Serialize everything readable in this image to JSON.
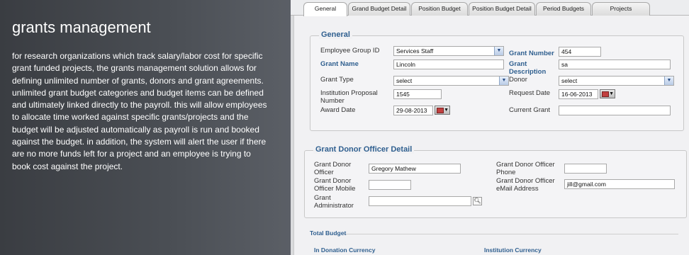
{
  "promo": {
    "heading": "grants management",
    "body": "for research organizations which track salary/labor cost for specific grant funded projects, the grants management solution allows for defining unlimited number of grants, donors and grant agreements.  unlimited grant budget categories and budget items can be defined and ultimately linked directly to the payroll.  this will allow employees to allocate time worked against specific grants/projects and the budget will be adjusted automatically as payroll is run and booked against the budget. in addition, the system will alert the user if there are no more funds left for a project and an employee is trying to book cost against the project."
  },
  "tabs": [
    {
      "label": "General",
      "active": true
    },
    {
      "label": "Grand Budget Detail"
    },
    {
      "label": "Position Budget"
    },
    {
      "label": "Position Budget Detail"
    },
    {
      "label": "Period Budgets"
    },
    {
      "label": "Projects"
    }
  ],
  "general": {
    "legend": "General",
    "employee_group_label": "Employee Group ID",
    "employee_group_value": "Services Staff",
    "grant_number_label": "Grant Number",
    "grant_number_value": "454",
    "grant_name_label": "Grant Name",
    "grant_name_value": "Lincoln",
    "grant_description_label": "Grant Description",
    "grant_description_value": "sa",
    "grant_type_label": "Grant Type",
    "grant_type_value": "select",
    "donor_label": "Donor",
    "donor_value": "select",
    "institution_proposal_label": "Institution Proposal Number",
    "institution_proposal_value": "1545",
    "request_date_label": "Request Date",
    "request_date_value": "16-06-2013",
    "award_date_label": "Award Date",
    "award_date_value": "29-08-2013",
    "current_grant_label": "Current Grant",
    "current_grant_value": ""
  },
  "donor_officer": {
    "legend": "Grant Donor Officer Detail",
    "officer_label": "Grant Donor Officer",
    "officer_value": "Gregory Mathew",
    "phone_label": "Grant Donor Officer Phone",
    "phone_value": "",
    "mobile_label": "Grant Donor Officer Mobile",
    "mobile_value": "",
    "email_label": "Grant Donor Officer eMail Address",
    "email_value": "jill@gmail.com",
    "administrator_label": "Grant Administrator",
    "administrator_value": ""
  },
  "budget": {
    "header": "Total Budget",
    "donation_currency": "In Donation Currency",
    "institution_currency": "Institution Currency"
  },
  "icons": {
    "dropdown": "chevron-down-icon",
    "calendar": "calendar-icon",
    "search": "magnifier-icon"
  },
  "colors": {
    "label_blue": "#2f5f8f",
    "promo_bg": "#45484d"
  }
}
